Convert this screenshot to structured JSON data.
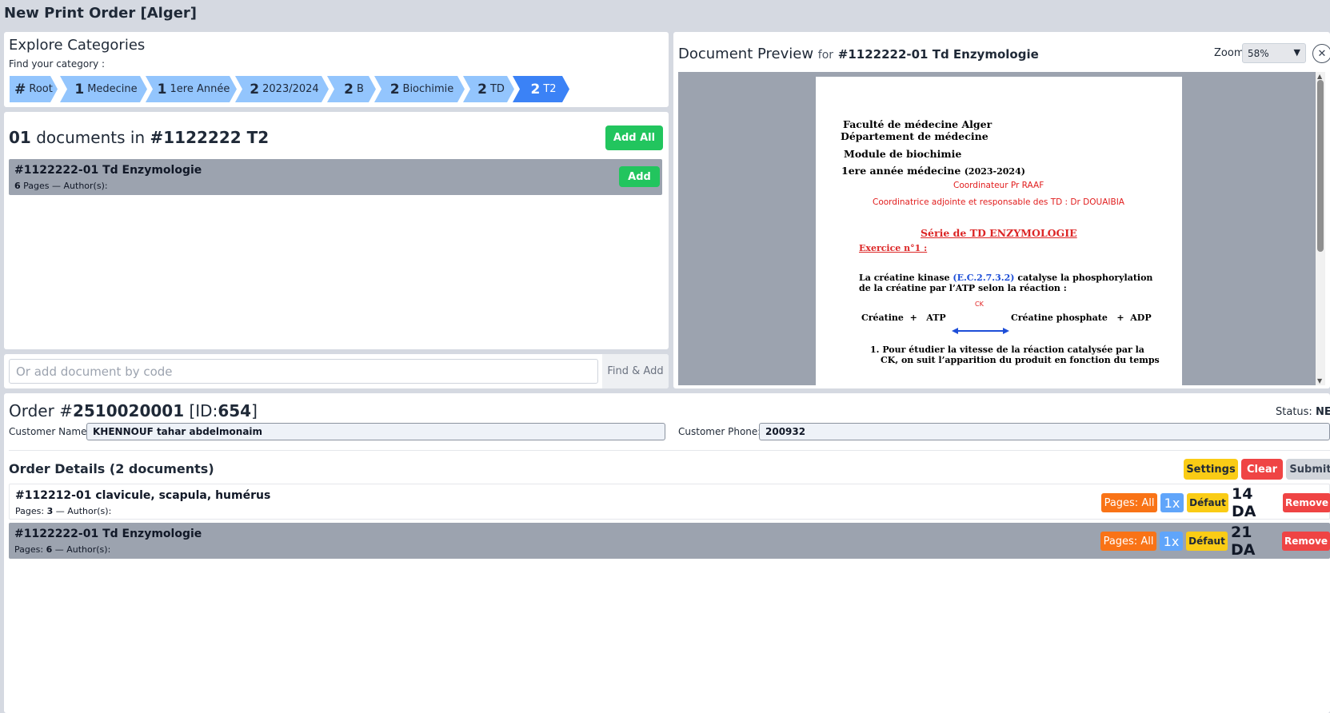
{
  "app": {
    "title": "New Print Order [Alger]"
  },
  "categories": {
    "title": "Explore Categories",
    "subtitle": "Find your category :",
    "crumbs": [
      {
        "num": "#",
        "label": "Root"
      },
      {
        "num": "1",
        "label": "Medecine"
      },
      {
        "num": "1",
        "label": "1ere Année"
      },
      {
        "num": "2",
        "label": "2023/2024"
      },
      {
        "num": "2",
        "label": "B"
      },
      {
        "num": "2",
        "label": "Biochimie"
      },
      {
        "num": "2",
        "label": "TD"
      },
      {
        "num": "2",
        "label": "T2"
      }
    ]
  },
  "documents": {
    "count": "01",
    "label": "documents in",
    "category": "#1122222 T2",
    "add_all": "Add All",
    "items": [
      {
        "title": "#1122222-01 Td Enzymologie",
        "pages": "6",
        "pages_label": "Pages — Author(s):",
        "add": "Add"
      }
    ]
  },
  "code": {
    "placeholder": "Or add document by code",
    "button": "Find & Add"
  },
  "preview": {
    "title": "Document Preview",
    "for": "for",
    "doc": "#1122222-01 Td Enzymologie",
    "zoom_label": "Zoom",
    "zoom_value": "58%",
    "close": "✕",
    "page": {
      "l1": "Faculté de médecine Alger",
      "l2": "Département de médecine",
      "l3": "Module de biochimie",
      "l4a": "1ere année médecine",
      "l4b": "(2023-2024)",
      "l5": "Coordinateur Pr RAAF",
      "l6": "Coordinatrice adjointe et responsable des TD : Dr DOUAIBIA",
      "l7": "Série de TD ENZYMOLOGIE",
      "l8": "Exercice n°1 :",
      "l9a": "La créatine kinase",
      "l9b": "(E.C.2.7.3.2)",
      "l9c": "catalyse la phosphorylation",
      "l10": "de la créatine par l’ATP selon la réaction :",
      "l11a": "Créatine  +   ATP",
      "l11ck": "CK",
      "l11b": "Créatine phosphate   +  ADP",
      "l12": "1. Pour étudier la vitesse de la réaction catalysée par la",
      "l13": "CK, on suit l’apparition du produit en fonction du temps"
    }
  },
  "order": {
    "prefix": "Order #",
    "number": "2510020001",
    "id_prefix": "[ID:",
    "id": "654",
    "id_suffix": "]",
    "status_label": "Status:",
    "status": "NEW",
    "customer_name_label": "Customer Name:",
    "customer_name": "KHENNOUF tahar abdelmonaim",
    "customer_phone_label": "Customer Phone:",
    "customer_phone": "200932",
    "details_title": "Order Details (2 documents)",
    "settings": "Settings",
    "clear": "Clear",
    "submit": "Submit",
    "items": [
      {
        "title": "#112212-01 clavicule, scapula, humérus",
        "meta_label": "Pages:",
        "pages": "3",
        "authors": "— Author(s):",
        "pages_btn": "Pages: All",
        "copies": "1x",
        "mode": "Défaut",
        "price": "14 DA",
        "remove": "Remove"
      },
      {
        "title": "#1122222-01 Td Enzymologie",
        "meta_label": "Pages:",
        "pages": "6",
        "authors": "— Author(s):",
        "pages_btn": "Pages: All",
        "copies": "1x",
        "mode": "Défaut",
        "price": "21 DA",
        "remove": "Remove"
      }
    ]
  },
  "colors": {
    "accent_blue": "#3b82f6",
    "crumb_blue": "#93c5fd",
    "green": "#22c55e",
    "orange": "#f97316",
    "yellow": "#facc15",
    "red": "#ef4444"
  }
}
